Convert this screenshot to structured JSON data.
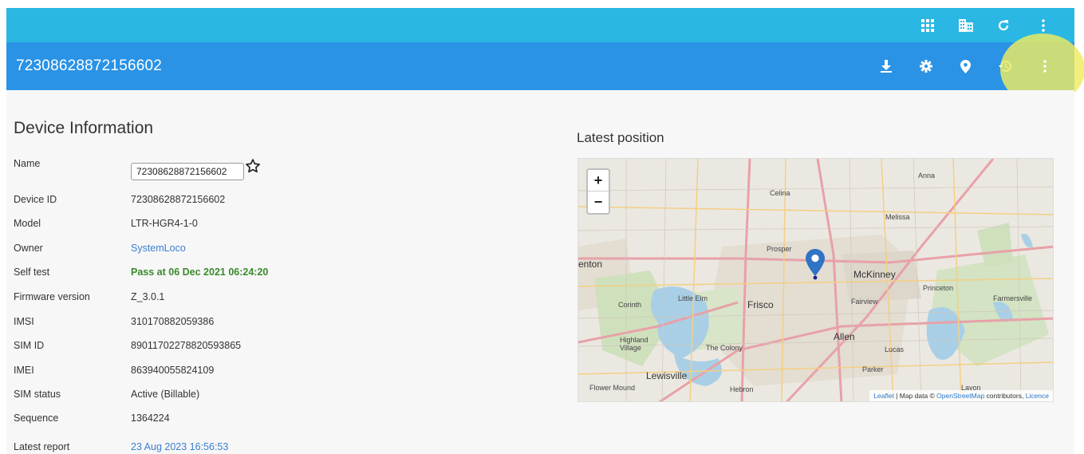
{
  "header": {
    "device_title": "72308628872156602"
  },
  "icons": {
    "top": [
      "grid-apps-icon",
      "business-icon",
      "refresh-icon",
      "more-vert-icon"
    ],
    "title": [
      "download-icon",
      "settings-icon",
      "location-pin-icon",
      "history-icon",
      "more-vert-icon"
    ]
  },
  "colors": {
    "top_bar": "#2bb7e3",
    "title_bar": "#2a93e6",
    "link": "#3a7fd0",
    "pass": "#3b8a2c",
    "highlight": "#eeec60"
  },
  "device_info": {
    "title": "Device Information",
    "name_label": "Name",
    "name_value": "72308628872156602",
    "rows": [
      {
        "label": "Device ID",
        "value": "72308628872156602"
      },
      {
        "label": "Model",
        "value": "LTR-HGR4-1-0"
      },
      {
        "label": "Owner",
        "value": "SystemLoco"
      },
      {
        "label": "Self test",
        "value": "Pass at 06 Dec 2021 06:24:20"
      },
      {
        "label": "Firmware version",
        "value": "Z_3.0.1"
      },
      {
        "label": "IMSI",
        "value": "310170882059386"
      },
      {
        "label": "SIM ID",
        "value": "89011702278820593865"
      },
      {
        "label": "IMEI",
        "value": "863940055824109"
      },
      {
        "label": "SIM status",
        "value": "Active (Billable)"
      },
      {
        "label": "Sequence",
        "value": "1364224"
      },
      {
        "label": "Latest report",
        "value": "23 Aug 2023 16:56:53"
      }
    ]
  },
  "map": {
    "title": "Latest position",
    "zoom_in": "+",
    "zoom_out": "−",
    "attribution_leaflet": "Leaflet",
    "attribution_mid": " | Map data © ",
    "attribution_osm": "OpenStreetMap",
    "attribution_contrib": " contributors, ",
    "attribution_licence": "Licence",
    "places": [
      "Anna",
      "Celina",
      "Melissa",
      "Prosper",
      "enton",
      "McKinney",
      "Princeton",
      "Farmersville",
      "Corinth",
      "Little Elm",
      "Frisco",
      "Fairview",
      "Allen",
      "Highland Village",
      "The Colony",
      "Lucas",
      "Parker",
      "Lewisville",
      "Flower Mound",
      "Hebron",
      "Lavon"
    ]
  }
}
